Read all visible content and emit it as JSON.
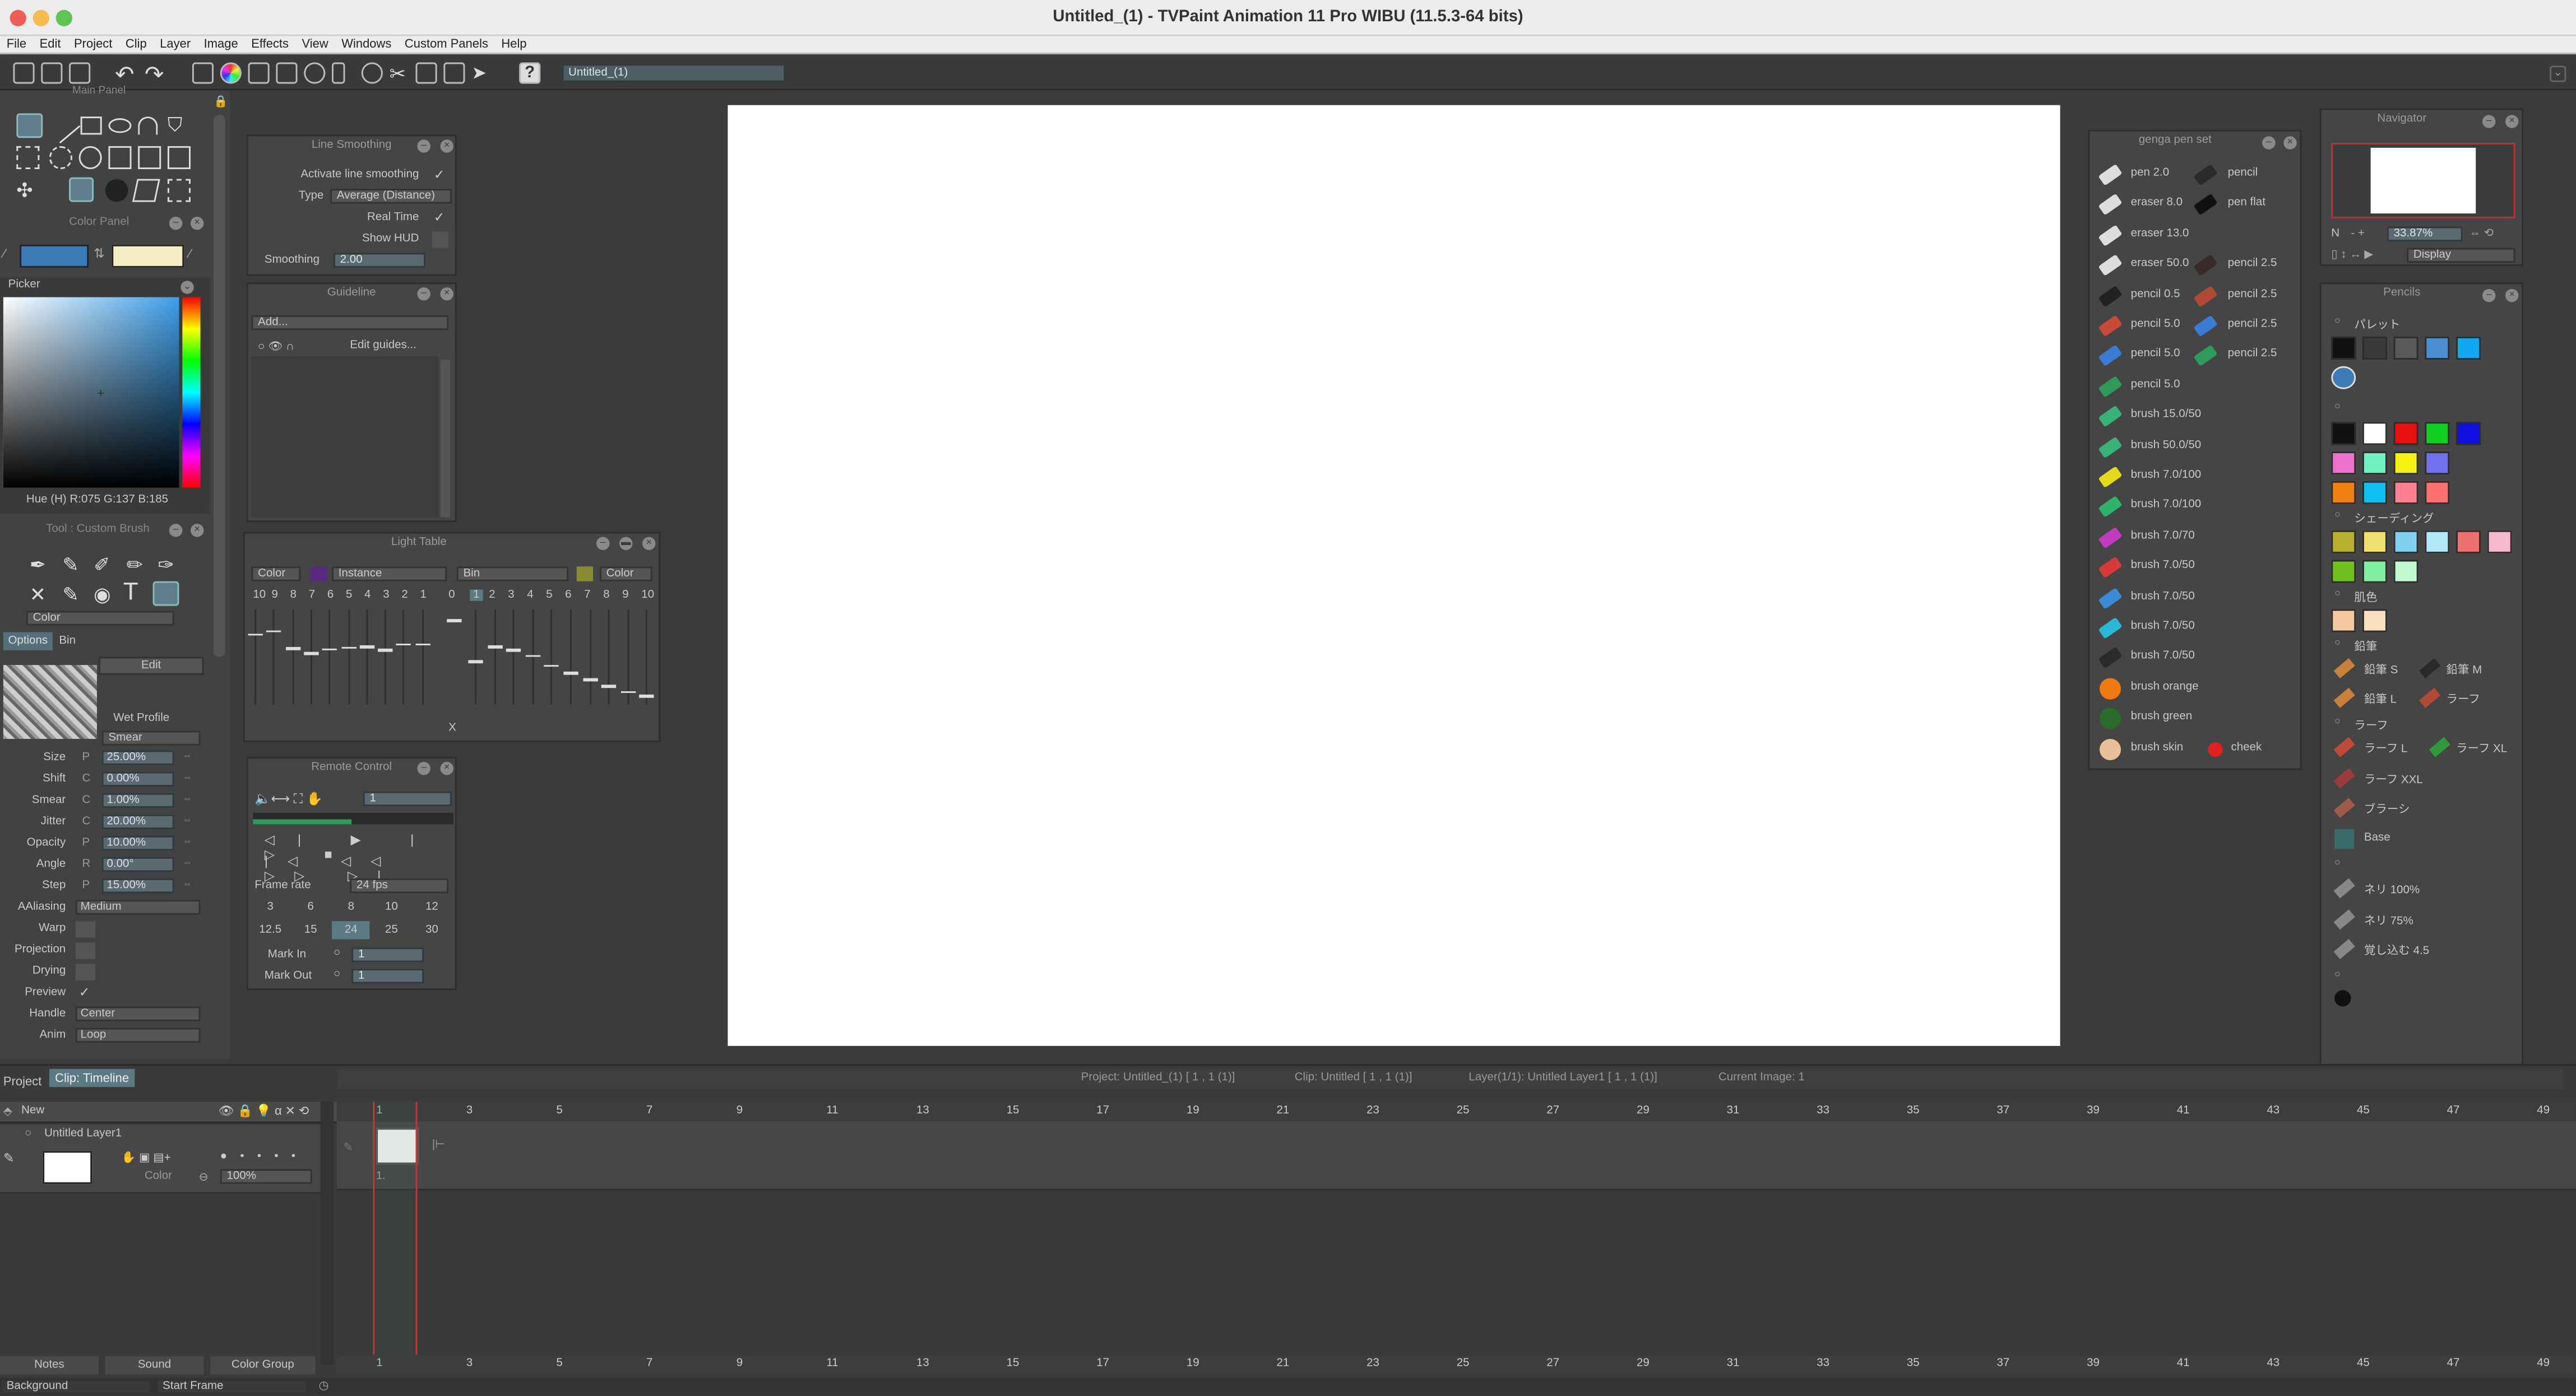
{
  "window": {
    "title": "Untitled_(1) - TVPaint Animation 11 Pro WIBU (11.5.3-64 bits)"
  },
  "menu": [
    "File",
    "Edit",
    "Project",
    "Clip",
    "Layer",
    "Image",
    "Effects",
    "View",
    "Windows",
    "Custom Panels",
    "Help"
  ],
  "toolbar": {
    "project_field": "Untitled_(1)"
  },
  "main_panel": {
    "title": "Main Panel"
  },
  "color_panel": {
    "title": "Color Panel",
    "primary_color": "#3d7bb6",
    "secondary_color": "#f4edc5"
  },
  "picker": {
    "title": "Picker",
    "readout": "Hue (H) R:075 G:137 B:185"
  },
  "tool_panel": {
    "title": "Tool : Custom Brush",
    "color_mode": "Color",
    "tabs": [
      "Options",
      "Bin"
    ],
    "edit_label": "Edit",
    "wet_profile": "Wet Profile",
    "smear_mode": "Smear",
    "params": [
      {
        "label": "Size",
        "mod": "P",
        "value": "25.00%"
      },
      {
        "label": "Shift",
        "mod": "C",
        "value": "0.00%"
      },
      {
        "label": "Smear",
        "mod": "C",
        "value": "1.00%"
      },
      {
        "label": "Jitter",
        "mod": "C",
        "value": "20.00%"
      },
      {
        "label": "Opacity",
        "mod": "P",
        "value": "10.00%"
      },
      {
        "label": "Angle",
        "mod": "R",
        "value": "0.00°"
      },
      {
        "label": "Step",
        "mod": "P",
        "value": "15.00%"
      }
    ],
    "aaliasing_label": "AAliasing",
    "aaliasing_value": "Medium",
    "warp_label": "Warp",
    "projection_label": "Projection",
    "drying_label": "Drying",
    "preview_label": "Preview",
    "handle_label": "Handle",
    "handle_value": "Center",
    "anim_label": "Anim",
    "anim_value": "Loop"
  },
  "line_smoothing": {
    "title": "Line Smoothing",
    "activate_label": "Activate line smoothing",
    "type_label": "Type",
    "type_value": "Average (Distance)",
    "realtime_label": "Real Time",
    "showhud_label": "Show HUD",
    "smoothing_label": "Smoothing",
    "smoothing_value": "2.00"
  },
  "guideline": {
    "title": "Guideline",
    "add_label": "Add...",
    "edit_label": "Edit guides..."
  },
  "light_table": {
    "title": "Light Table",
    "left_color": "Color",
    "instance": "Instance",
    "bin": "Bin",
    "right_color": "Color",
    "left_numbers": [
      "10",
      "9",
      "8",
      "7",
      "6",
      "5",
      "4",
      "3",
      "2",
      "1"
    ],
    "center": "0",
    "right_numbers": [
      "1",
      "2",
      "3",
      "4",
      "5",
      "6",
      "7",
      "8",
      "9",
      "10"
    ],
    "x_label": "X"
  },
  "remote_control": {
    "title": "Remote Control",
    "frame_field": "1",
    "frame_rate_label": "Frame rate",
    "frame_rate_value": "24 fps",
    "rates_row1": [
      "3",
      "6",
      "8",
      "10",
      "12"
    ],
    "rates_row2": [
      "12.5",
      "15",
      "24",
      "25",
      "30"
    ],
    "mark_in_label": "Mark In",
    "mark_in_value": "1",
    "mark_out_label": "Mark Out",
    "mark_out_value": "1"
  },
  "genga": {
    "title": "genga pen set",
    "items": [
      {
        "label": "pen 2.0",
        "color": "#dddddd",
        "label2": "pencil",
        "color2": "#2a2a2a"
      },
      {
        "label": "eraser 8.0",
        "color": "#dddddd",
        "label2": "pen flat",
        "color2": "#111111"
      },
      {
        "label": "eraser 13.0",
        "color": "#dddddd",
        "label2": "",
        "color2": ""
      },
      {
        "label": "eraser 50.0",
        "color": "#dddddd",
        "label2": "pencil 2.5",
        "color2": "#3a2a2a"
      },
      {
        "label": "pencil 0.5",
        "color": "#222222",
        "label2": "pencil 2.5",
        "color2": "#b04a36"
      },
      {
        "label": "pencil 5.0",
        "color": "#c84a3a",
        "label2": "pencil 2.5",
        "color2": "#3a7bd5"
      },
      {
        "label": "pencil 5.0",
        "color": "#3a7bd5",
        "label2": "pencil 2.5",
        "color2": "#2f9a5a"
      },
      {
        "label": "pencil 5.0",
        "color": "#2f9a5a",
        "label2": "",
        "color2": ""
      },
      {
        "label": "brush 15.0/50",
        "color": "#39b27a",
        "label2": "",
        "color2": ""
      },
      {
        "label": "brush 50.0/50",
        "color": "#39b27a",
        "label2": "",
        "color2": ""
      },
      {
        "label": "brush 7.0/100",
        "color": "#e6d81a",
        "label2": "",
        "color2": ""
      },
      {
        "label": "brush 7.0/100",
        "color": "#2fb36a",
        "label2": "",
        "color2": ""
      },
      {
        "label": "brush 7.0/70",
        "color": "#c23ac2",
        "label2": "",
        "color2": ""
      },
      {
        "label": "brush 7.0/50",
        "color": "#d83a3a",
        "label2": "",
        "color2": ""
      },
      {
        "label": "brush 7.0/50",
        "color": "#3a8ad8",
        "label2": "",
        "color2": ""
      },
      {
        "label": "brush 7.0/50",
        "color": "#2ab8d8",
        "label2": "",
        "color2": ""
      },
      {
        "label": "brush 7.0/50",
        "color": "#2a2a2a",
        "label2": "",
        "color2": ""
      },
      {
        "label": "brush orange",
        "color": "#f07a10",
        "label2": "",
        "color2": ""
      },
      {
        "label": "brush green",
        "color": "#2a6a2a",
        "label2": "",
        "color2": ""
      },
      {
        "label": "brush skin",
        "color": "#e8c09a",
        "label2": "cheek",
        "color2": "#e02020"
      }
    ]
  },
  "navigator": {
    "title": "Navigator",
    "zoom": "33.87%",
    "display": "Display",
    "n_label": "N"
  },
  "pencils": {
    "title": "Pencils",
    "sec_palette": "パレット",
    "palette1": [
      "#111111",
      "#3a3a3a",
      "#5a5a5a",
      "#4a90d0",
      "#10a8f0"
    ],
    "palette1_b": [
      "#3d7bb6"
    ],
    "palette2": [
      [
        "#111111",
        "#ffffff",
        "#e81010",
        "#10d020",
        "#1010e0"
      ],
      [
        "#f070d0",
        "#70f0c0",
        "#f8f010",
        "#7070f0"
      ],
      [
        "#f08010",
        "#10c0f0",
        "#ff8090",
        "#ff7070"
      ]
    ],
    "sec_shading": "シェーディング",
    "shading": [
      [
        "#b8b030",
        "#f0e070",
        "#80d0f0",
        "#b0e8f8",
        "#f07070",
        "#f8b8d0"
      ],
      [
        "#70c020",
        "#80f0a0",
        "#c0f8d0"
      ]
    ],
    "sec_skin": "肌色",
    "skin": [
      "#f4c8a0",
      "#f8e0c0"
    ],
    "sec_pencil": "鉛筆",
    "pencil_items": [
      [
        "鉛筆 S",
        "鉛筆 M"
      ],
      [
        "鉛筆 L",
        "ラーフ"
      ]
    ],
    "sec_rough": "ラーフ",
    "rough_items": [
      "ラーフ L",
      "ラーフ XL",
      "ラーフ XXL",
      "ブラーシ",
      "Base"
    ],
    "extra_items": [
      "ネリ 100%",
      "ネリ 75%",
      "覚し込む 4.5"
    ]
  },
  "timeline": {
    "tabs": [
      "Project",
      "Clip: Timeline"
    ],
    "status_project": "Project: Untitled_(1) [ 1 , 1  (1)]",
    "status_clip": "Clip: Untitled [ 1 , 1  (1)]",
    "status_layer": "Layer(1/1): Untitled Layer1 [ 1 , 1  (1)]",
    "status_image": "Current Image: 1",
    "new_label": "New",
    "layer_name": "Untitled Layer1",
    "layer_mode": "Color",
    "layer_opacity": "100%",
    "frame_numbers": [
      "1",
      "3",
      "5",
      "7",
      "9",
      "11",
      "13",
      "15",
      "17",
      "19",
      "21",
      "23",
      "25",
      "27",
      "29",
      "31",
      "33",
      "35",
      "37",
      "39",
      "41",
      "43",
      "45",
      "47",
      "49"
    ],
    "bottom_tabs": [
      "Notes",
      "Sound",
      "Color Group"
    ],
    "background_label": "Background",
    "start_frame_label": "Start Frame",
    "frame_label": "1."
  }
}
